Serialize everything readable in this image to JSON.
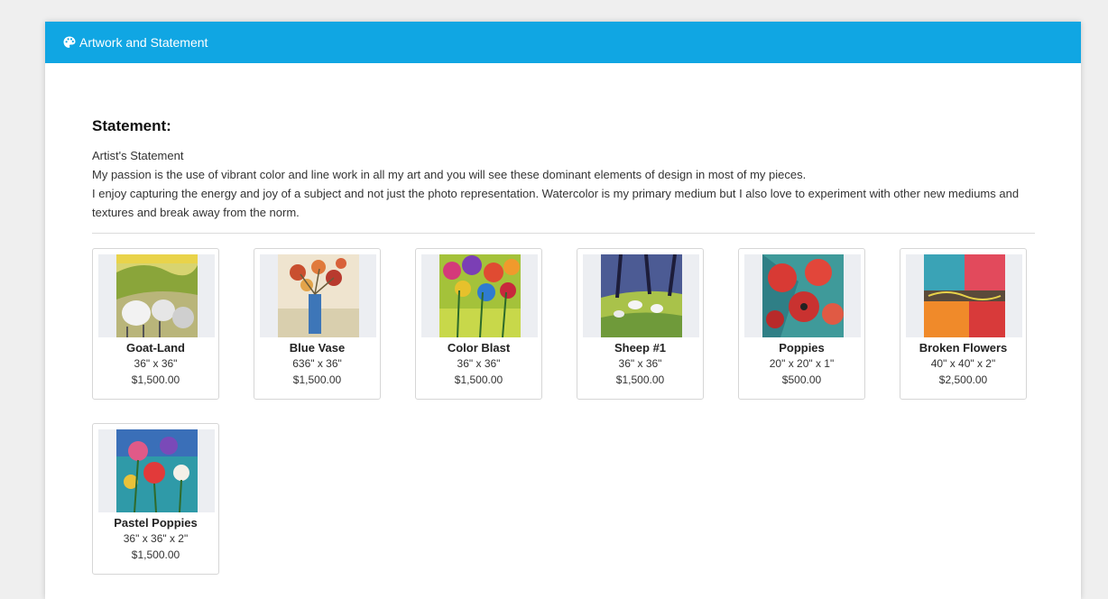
{
  "header": {
    "title": "Artwork and Statement",
    "icon": "palette-icon",
    "color": "#10a6e3"
  },
  "statement": {
    "heading": "Statement:",
    "subheading": "Artist's Statement",
    "paragraph1": "My passion is the use of vibrant color and line work in all my art and you will see these dominant elements of design in most of my pieces.",
    "paragraph2": "I enjoy capturing the energy and joy of a subject and not just the photo representation. Watercolor is my primary medium but I also love to experiment with other new mediums and textures and break away from the norm."
  },
  "artworks": [
    {
      "title": "Goat-Land",
      "dimensions": "36\" x 36\"",
      "price": "$1,500.00"
    },
    {
      "title": "Blue Vase",
      "dimensions": "636\" x 36\"",
      "price": "$1,500.00"
    },
    {
      "title": "Color Blast",
      "dimensions": "36\" x 36\"",
      "price": "$1,500.00"
    },
    {
      "title": "Sheep #1",
      "dimensions": "36\" x 36\"",
      "price": "$1,500.00"
    },
    {
      "title": "Poppies",
      "dimensions": "20\" x 20\" x 1\"",
      "price": "$500.00"
    },
    {
      "title": "Broken Flowers",
      "dimensions": "40\" x 40\" x 2\"",
      "price": "$2,500.00"
    },
    {
      "title": "Pastel Poppies",
      "dimensions": "36\" x 36\" x 2\"",
      "price": "$1,500.00"
    }
  ]
}
